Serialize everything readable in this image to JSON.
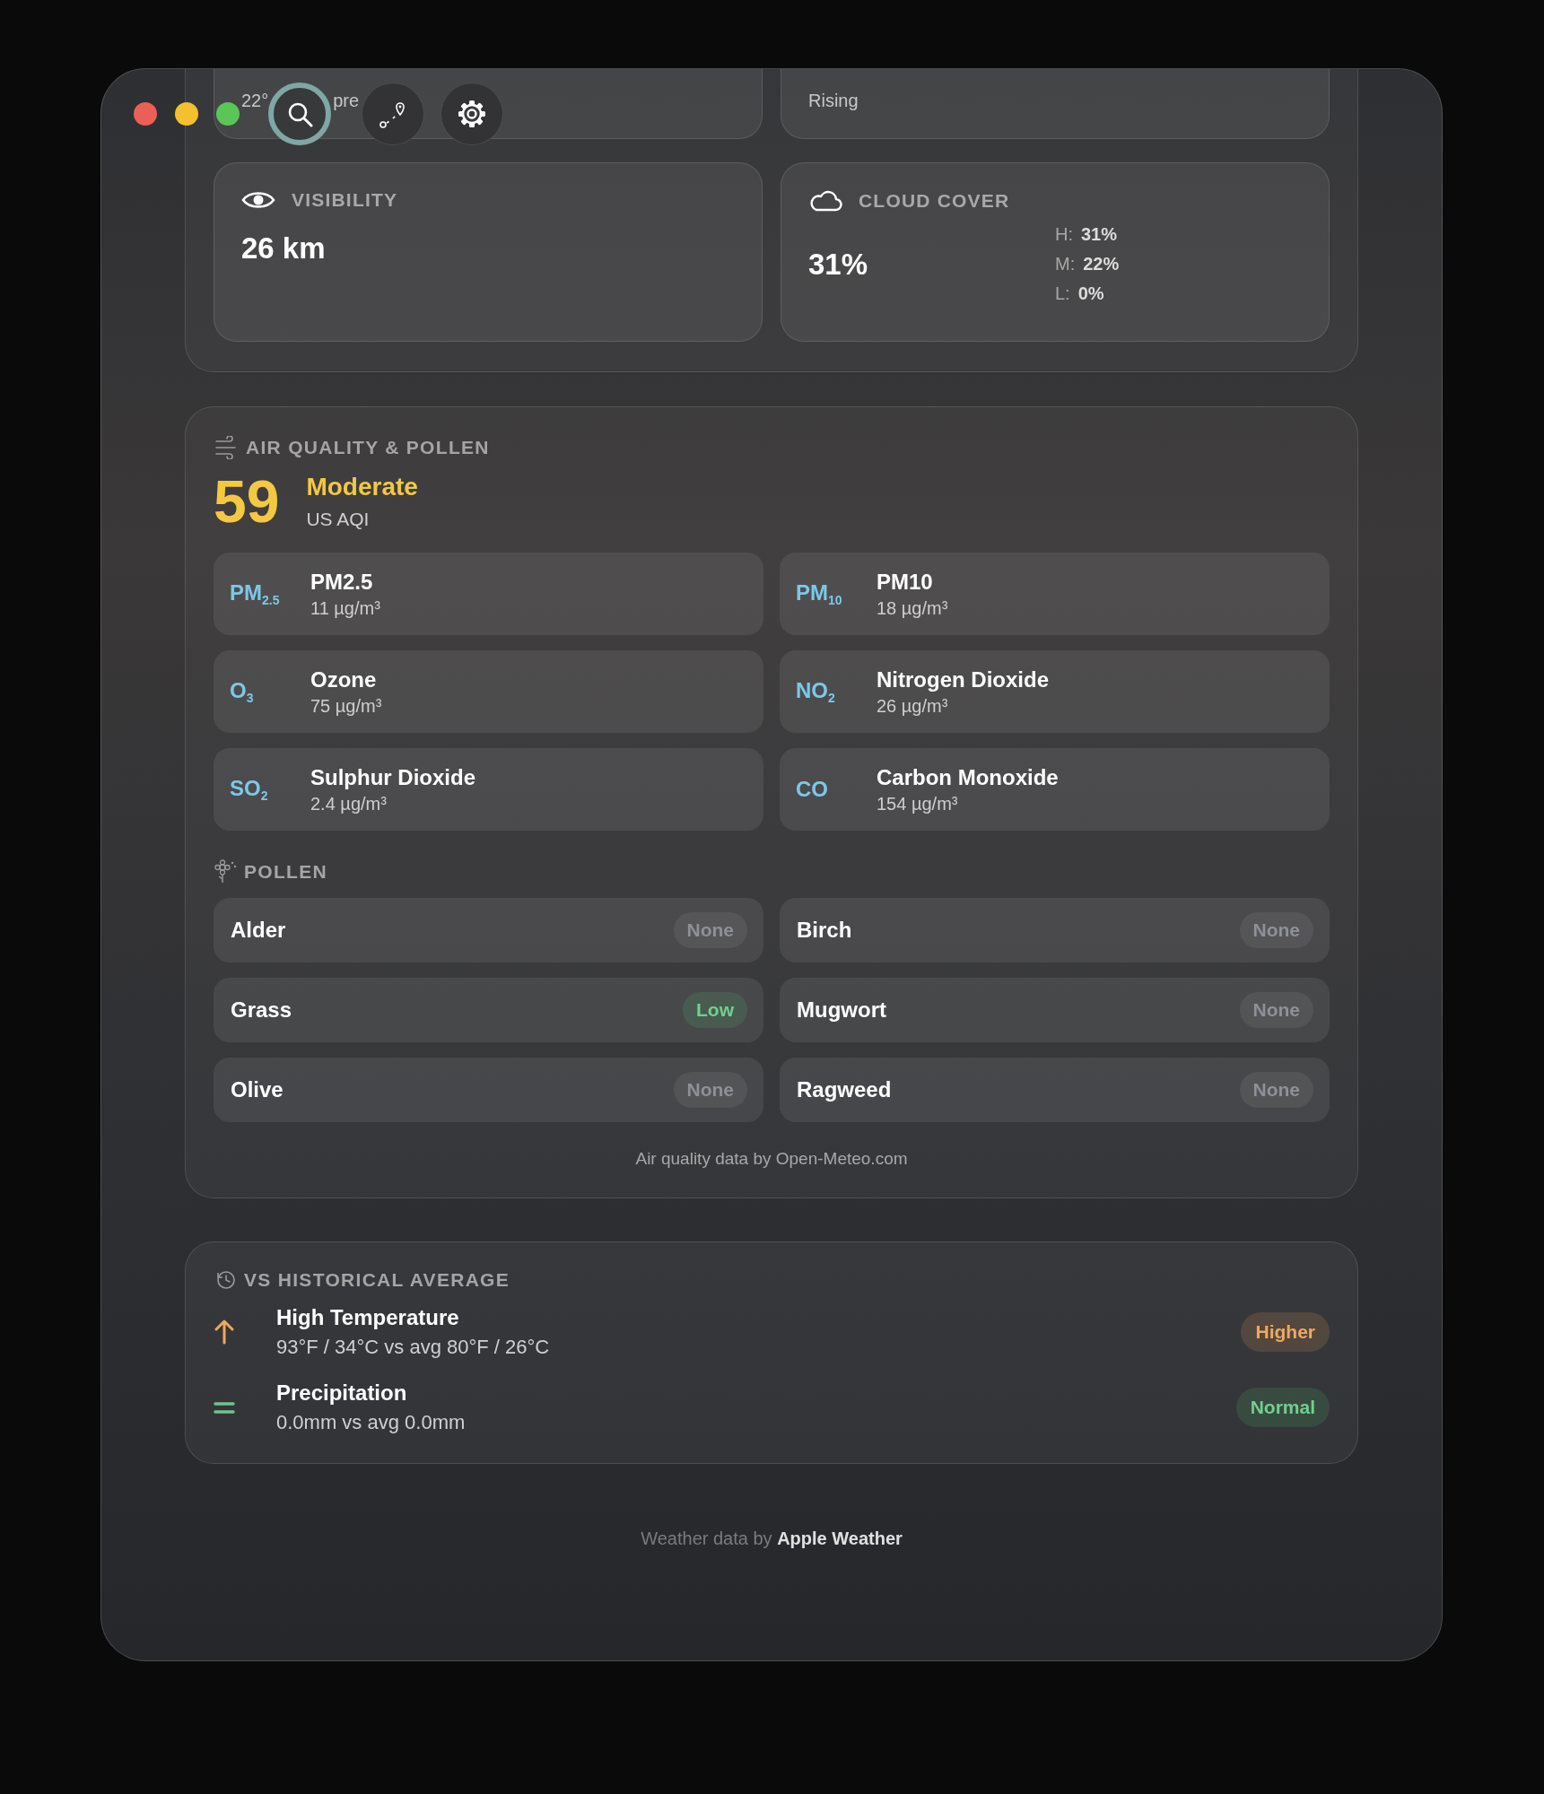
{
  "window": {
    "controls": [
      {
        "color": "#ec5f57"
      },
      {
        "color": "#f4c030"
      },
      {
        "color": "#5bc658"
      }
    ]
  },
  "toolbar": [
    {
      "kind": "search",
      "focused": true
    },
    {
      "kind": "route",
      "focused": false
    },
    {
      "kind": "settings",
      "focused": false
    }
  ],
  "conditions": {
    "cards": [
      {
        "kind": "partial",
        "texts": [
          "22°",
          "pre"
        ]
      },
      {
        "kind": "partial",
        "texts": [
          "Rising"
        ]
      },
      {
        "kind": "metric",
        "label": "VISIBILITY",
        "value": "26 km"
      },
      {
        "kind": "layers",
        "label": "CLOUD COVER",
        "value": "31%",
        "layers": [
          {
            "label": "H:",
            "value": "31%"
          },
          {
            "label": "M:",
            "value": "22%"
          },
          {
            "label": "L:",
            "value": "0%"
          }
        ]
      }
    ]
  },
  "air_quality": {
    "title": "AIR QUALITY & POLLEN",
    "aqi": {
      "value": "59",
      "category": "Moderate",
      "color": "#f5c842",
      "scale": "US AQI"
    },
    "pollutants": [
      {
        "symbol": "PM$_{2.5}$",
        "name": "PM2.5",
        "value": "11 µg/m³"
      },
      {
        "symbol": "PM$_{10}$",
        "name": "PM10",
        "value": "18 µg/m³"
      },
      {
        "symbol": "O$_{3}$",
        "name": "Ozone",
        "value": "75 µg/m³"
      },
      {
        "symbol": "NO$_{2}$",
        "name": "Nitrogen Dioxide",
        "value": "26 µg/m³"
      },
      {
        "symbol": "SO$_{2}$",
        "name": "Sulphur Dioxide",
        "value": "2.4 µg/m³"
      },
      {
        "symbol": "CO",
        "name": "Carbon Monoxide",
        "value": "154 µg/m³"
      }
    ],
    "pollen": {
      "title": "POLLEN",
      "items": [
        {
          "name": "Alder",
          "level": "None",
          "kind": "neutral"
        },
        {
          "name": "Birch",
          "level": "None",
          "kind": "neutral"
        },
        {
          "name": "Grass",
          "level": "Low",
          "kind": "good"
        },
        {
          "name": "Mugwort",
          "level": "None",
          "kind": "neutral"
        },
        {
          "name": "Olive",
          "level": "None",
          "kind": "neutral"
        },
        {
          "name": "Ragweed",
          "level": "None",
          "kind": "neutral"
        }
      ]
    },
    "attribution": "Air quality data by Open-Meteo.com"
  },
  "historical": {
    "title": "VS HISTORICAL AVERAGE",
    "rows": [
      {
        "kind": "above",
        "title": "High Temperature",
        "detail": "93°F / 34°C vs avg 80°F / 26°C",
        "badge": "Higher"
      },
      {
        "kind": "normal",
        "title": "Precipitation",
        "detail": "0.0mm vs avg 0.0mm",
        "badge": "Normal"
      }
    ]
  },
  "footer": {
    "text": "Weather data by **Apple Weather**"
  }
}
